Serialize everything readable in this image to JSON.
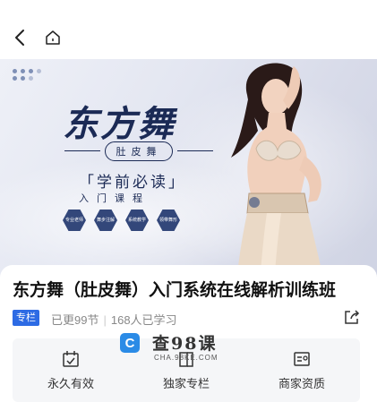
{
  "nav": {
    "back_icon": "chevron-left-icon",
    "home_icon": "home-icon"
  },
  "banner": {
    "title": "东方舞",
    "subtitle": "肚皮舞",
    "must_read": "「学前必读」",
    "intro": "入门课程",
    "hex_badges": [
      "专业老师",
      "舞步注解",
      "系统教学",
      "领带舞形"
    ],
    "accent_color": "#1b2a55"
  },
  "course": {
    "title": "东方舞（肚皮舞）入门系统在线解析训练班",
    "tag": "专栏",
    "updated": "已更99节",
    "learners": "168人已学习",
    "share_icon": "share-icon"
  },
  "features": [
    {
      "label": "永久有效",
      "icon": "calendar-check-icon"
    },
    {
      "label": "独家专栏",
      "icon": "book-icon"
    },
    {
      "label": "商家资质",
      "icon": "id-card-icon"
    }
  ],
  "watermark": {
    "logo": "C",
    "text": "查98课",
    "url": "CHA.98KE.COM"
  }
}
